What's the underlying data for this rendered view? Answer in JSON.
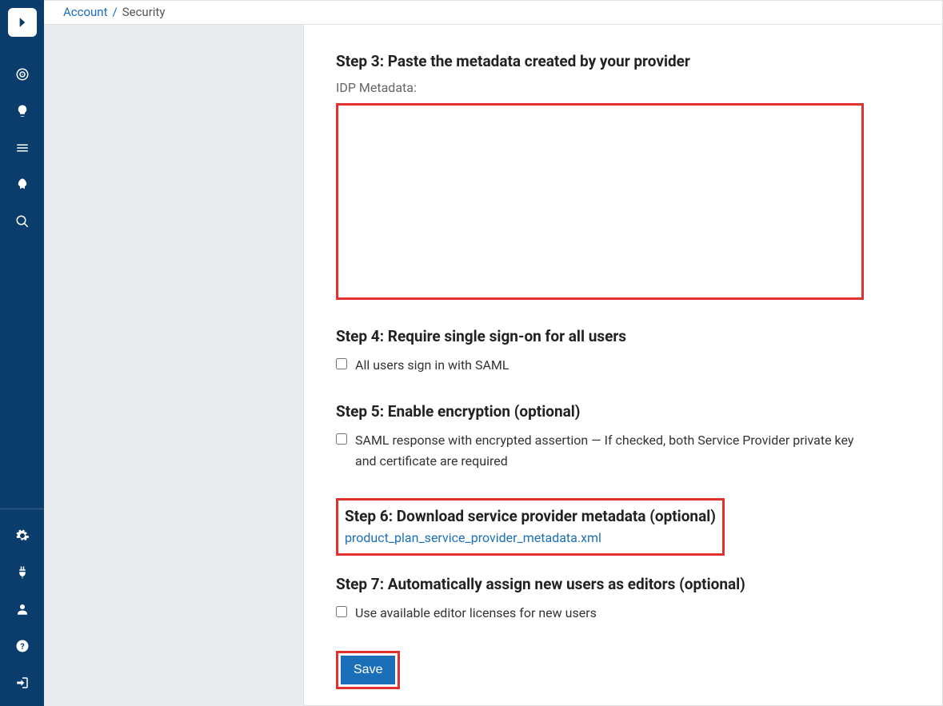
{
  "breadcrumb": {
    "parent": "Account",
    "separator": "/",
    "current": "Security"
  },
  "steps": {
    "step3": {
      "title": "Step 3: Paste the metadata created by your provider",
      "field_label": "IDP Metadata:",
      "value": ""
    },
    "step4": {
      "title": "Step 4: Require single sign-on for all users",
      "checkbox_label": "All users sign in with SAML"
    },
    "step5": {
      "title": "Step 5: Enable encryption (optional)",
      "checkbox_label": "SAML response with encrypted assertion — If checked, both Service Provider private key and certificate are required"
    },
    "step6": {
      "title": "Step 6: Download service provider metadata (optional)",
      "link_text": "product_plan_service_provider_metadata.xml"
    },
    "step7": {
      "title": "Step 7: Automatically assign new users as editors (optional)",
      "checkbox_label": "Use available editor licenses for new users"
    }
  },
  "buttons": {
    "save": "Save"
  }
}
